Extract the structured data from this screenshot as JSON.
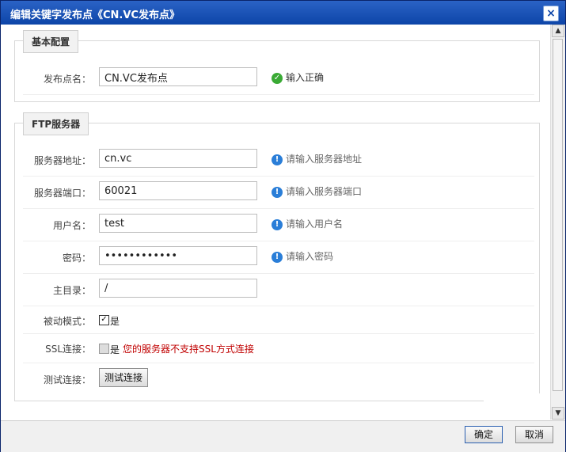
{
  "dialog": {
    "title": "编辑关键字发布点《CN.VC发布点》",
    "close_label": "×"
  },
  "basic": {
    "legend": "基本配置",
    "name_label": "发布点名：",
    "name_value": "CN.VC发布点",
    "name_hint": "输入正确"
  },
  "ftp": {
    "legend": "FTP服务器",
    "address_label": "服务器地址：",
    "address_value": "cn.vc",
    "address_hint": "请输入服务器地址",
    "port_label": "服务器端口：",
    "port_value": "60021",
    "port_hint": "请输入服务器端口",
    "user_label": "用户名：",
    "user_value": "test",
    "user_hint": "请输入用户名",
    "password_label": "密码：",
    "password_value": "••••••••••••",
    "password_hint": "请输入密码",
    "home_label": "主目录：",
    "home_value": "/",
    "passive_label": "被动模式：",
    "passive_checked": true,
    "passive_option": "是",
    "ssl_label": "SSL连接：",
    "ssl_checked": false,
    "ssl_option": "是",
    "ssl_warning": "您的服务器不支持SSL方式连接",
    "test_label": "测试连接：",
    "test_button": "测试连接"
  },
  "footer": {
    "ok_label": "确定",
    "cancel_label": "取消"
  },
  "icons": {
    "ok": "check-circle-icon",
    "info": "info-circle-icon",
    "scroll_up": "arrow-up-icon",
    "scroll_down": "arrow-down-icon"
  },
  "colors": {
    "title_bar": "#0d45a8",
    "ok_icon": "#3aaa35",
    "info_icon": "#2a7ed8",
    "warning_text": "#c00000"
  }
}
